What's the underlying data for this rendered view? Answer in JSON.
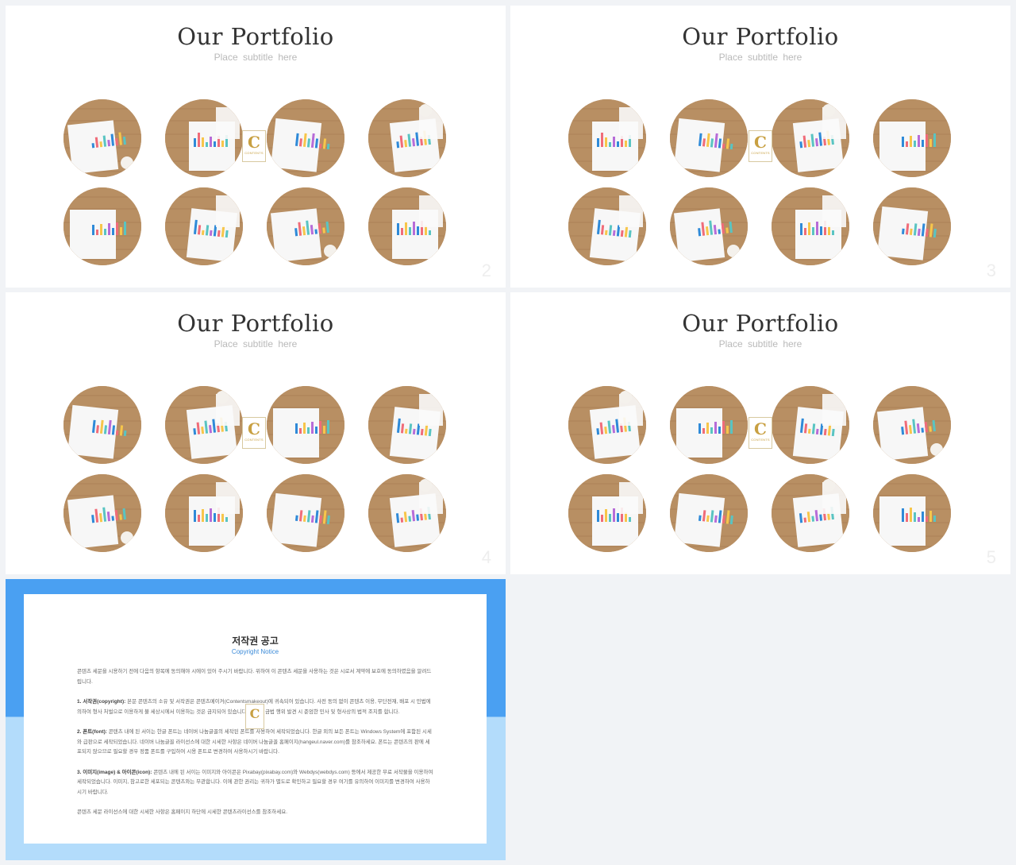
{
  "slides": [
    {
      "id": "s2",
      "title": "Our Portfolio",
      "subtitle": "Place subtitle here",
      "number": "2"
    },
    {
      "id": "s3",
      "title": "Our Portfolio",
      "subtitle": "Place subtitle here",
      "number": "3"
    },
    {
      "id": "s4",
      "title": "Our Portfolio",
      "subtitle": "Place subtitle here",
      "number": "4"
    },
    {
      "id": "s5",
      "title": "Our Portfolio",
      "subtitle": "Place subtitle here",
      "number": "5"
    }
  ],
  "logo": {
    "letter": "C",
    "text": "CONTENTS"
  },
  "copyright": {
    "title": "저작권 공고",
    "subtitle": "Copyright Notice",
    "intro": "콘텐츠 세문을 시용하기 전에 다음의 항목에 동의해야 시에이 있어 주시기 바랍니다. 위하여 이 콘텐츠 세문을 사용하는 것은 시로서 계약에 보호에 동의하였음을 알려드립니다.",
    "p1_head": "1. 서작권(copyright):",
    "p1": "본문 콘텐츠의 소유 및 서작권은 콘텐츠메이커(Contentsmakeout)에 귀속되어 있습니다. 사전 동의 없이 콘텐츠 이용, 무단전재, 배포 시 민법에 의하여 형사 처벌으로 이용하게 불 세상시에서 이용하는 것은 금지되어 있습니다. 이러한 금법 행위 발견 시 준엄한 민사 및 형사상의 법적 조치를 합니다.",
    "p2_head": "2. 폰트(font):",
    "p2": "콘텐츠 내에 된 서이는 한글 폰트는 네이버 나눔글꼴의 세작된 폰트를 사용하여 세작되었습니다. 한글 외의 보든 폰트는 Windows System에 포함된 시세와 급판으로 세작되었습니다. 네이버 나눔글꼴 라이선스에 대한 시세한 사항은 네이버 나눔글꼴 홈페이지(hangeul.naver.com)를 참조하세요. 폰트는 콘텐츠의 판에 세포되지 않으므로 필요할 경우 정품 폰트를 구입하여 시용 폰트로 변경하여 사용하시기 바랍니다.",
    "p3_head": "3. 이미지(image) & 아이콘(icon):",
    "p3": "콘텐츠 내에 된 서이는 이미지와 아이콘은 Pixabay(pixabay.com)와 Webdys(webdys.com) 등에서 제공한 무료 서작물을 이용하여 세작되었습니다. 이미지, 참고로한 세포되는 콘텐츠와는 무관합니다. 이에 관한 권리는 귀하가 별도로 확인하고 필요할 경우 여기를 유의하여 이미지를 변경하여 사용하시기 바랍니다.",
    "outro": "콘텐츠 세문 라이선스에 대한 시세한 사항은 홈페이지 하단에 시세한 콘텐츠라이선스를 참조하세요."
  }
}
